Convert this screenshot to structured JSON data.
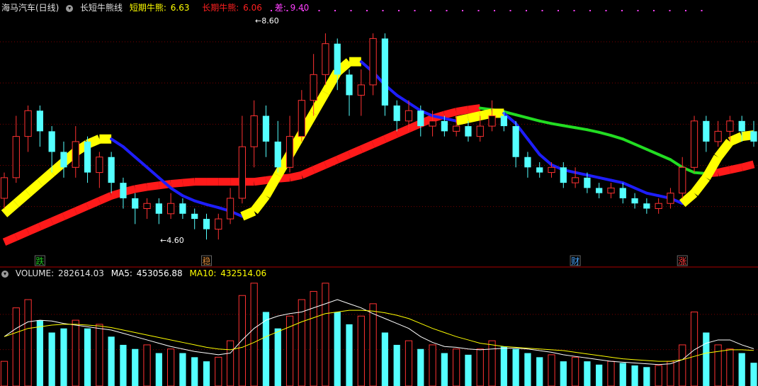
{
  "top_panel": {
    "stock_name": "海马汽车(日线)",
    "indicator_name": "长短牛熊线",
    "short_label": "短期牛熊:",
    "short_value": "6.63",
    "long_label": "长期牛熊:",
    "long_value": "6.06",
    "diff_label": "差:",
    "diff_value": "9.40",
    "high_marker": "8.60",
    "low_marker": "4.60",
    "signals": [
      {
        "label": "跌",
        "color": "#21c021"
      },
      {
        "label": "稳",
        "color": "#d98a3a"
      },
      {
        "label": "财",
        "color": "#4aa8ff"
      },
      {
        "label": "涨",
        "color": "#ff3c3c"
      }
    ]
  },
  "bottom_panel": {
    "volume_label": "VOLUME:",
    "volume_value": "282614.03",
    "ma5_label": "MA5:",
    "ma5_value": "453056.88",
    "ma10_label": "MA10:",
    "ma10_value": "432514.06"
  },
  "colors": {
    "up_candle": "#ff3232",
    "down_candle": "#54ffff",
    "short_line_rising": "#ffff00",
    "short_line_falling": "#1e1eff",
    "long_line_rising": "#ff1a1a",
    "long_line_falling": "#22dd22",
    "ma5": "#ffffff",
    "ma10": "#ffff00",
    "grid": "#7a0000"
  },
  "chart_data": {
    "type": "candlestick",
    "price_ylim": [
      4.3,
      9.0
    ],
    "volume_ylim": [
      0,
      1300000
    ],
    "short_line": [
      5.1,
      5.3,
      5.5,
      5.7,
      5.9,
      6.1,
      6.3,
      6.45,
      6.55,
      6.55,
      6.4,
      6.2,
      6.0,
      5.8,
      5.6,
      5.45,
      5.35,
      5.28,
      5.22,
      5.15,
      5.05,
      5.15,
      5.45,
      5.85,
      6.25,
      6.65,
      7.05,
      7.45,
      7.85,
      8.05,
      8.05,
      7.85,
      7.6,
      7.4,
      7.25,
      7.1,
      7.0,
      6.95,
      6.9,
      6.95,
      7.0,
      7.05,
      7.05,
      6.85,
      6.55,
      6.25,
      6.05,
      5.95,
      5.9,
      5.85,
      5.8,
      5.75,
      5.7,
      5.6,
      5.5,
      5.45,
      5.4,
      5.3,
      5.5,
      5.8,
      6.2,
      6.5,
      6.6,
      6.63
    ],
    "long_line": [
      4.55,
      4.65,
      4.75,
      4.85,
      4.95,
      5.05,
      5.15,
      5.25,
      5.35,
      5.45,
      5.52,
      5.58,
      5.62,
      5.65,
      5.68,
      5.7,
      5.72,
      5.72,
      5.72,
      5.72,
      5.72,
      5.72,
      5.75,
      5.78,
      5.8,
      5.85,
      5.95,
      6.05,
      6.15,
      6.25,
      6.35,
      6.45,
      6.55,
      6.65,
      6.75,
      6.85,
      6.95,
      7.02,
      7.08,
      7.12,
      7.15,
      7.12,
      7.08,
      7.02,
      6.96,
      6.9,
      6.85,
      6.81,
      6.77,
      6.73,
      6.68,
      6.62,
      6.55,
      6.45,
      6.35,
      6.25,
      6.15,
      6.0,
      5.9,
      5.88,
      5.9,
      5.95,
      6.0,
      6.06
    ],
    "candles": [
      [
        5.4,
        5.8,
        5.9,
        5.2
      ],
      [
        5.8,
        6.6,
        7.0,
        5.7
      ],
      [
        6.6,
        7.1,
        7.2,
        6.3
      ],
      [
        7.1,
        6.7,
        7.2,
        6.4
      ],
      [
        6.7,
        6.3,
        6.8,
        5.9
      ],
      [
        6.3,
        6.0,
        6.5,
        5.8
      ],
      [
        6.0,
        6.5,
        6.8,
        5.8
      ],
      [
        6.5,
        5.9,
        6.6,
        5.7
      ],
      [
        5.9,
        6.2,
        6.3,
        5.6
      ],
      [
        6.2,
        5.7,
        6.3,
        5.5
      ],
      [
        5.7,
        5.4,
        5.8,
        5.2
      ],
      [
        5.4,
        5.2,
        5.5,
        4.9
      ],
      [
        5.2,
        5.3,
        5.4,
        5.0
      ],
      [
        5.3,
        5.1,
        5.4,
        4.9
      ],
      [
        5.1,
        5.3,
        5.5,
        5.0
      ],
      [
        5.3,
        5.1,
        5.4,
        5.0
      ],
      [
        5.1,
        5.0,
        5.2,
        4.8
      ],
      [
        5.0,
        4.8,
        5.1,
        4.6
      ],
      [
        4.8,
        5.0,
        5.1,
        4.6
      ],
      [
        5.0,
        5.4,
        5.6,
        4.9
      ],
      [
        5.4,
        6.4,
        7.0,
        5.3
      ],
      [
        6.4,
        7.0,
        7.3,
        6.0
      ],
      [
        7.0,
        6.5,
        7.2,
        6.2
      ],
      [
        6.5,
        6.0,
        6.9,
        5.9
      ],
      [
        6.0,
        6.6,
        7.0,
        5.9
      ],
      [
        6.6,
        7.3,
        7.5,
        6.5
      ],
      [
        7.3,
        7.8,
        8.2,
        7.0
      ],
      [
        7.8,
        8.4,
        8.6,
        7.6
      ],
      [
        8.4,
        7.8,
        8.5,
        7.5
      ],
      [
        7.8,
        7.4,
        7.9,
        7.0
      ],
      [
        7.4,
        7.6,
        7.9,
        7.0
      ],
      [
        7.6,
        8.5,
        8.6,
        7.4
      ],
      [
        8.5,
        7.2,
        8.6,
        7.0
      ],
      [
        7.2,
        6.9,
        7.3,
        6.7
      ],
      [
        6.9,
        7.1,
        7.3,
        6.7
      ],
      [
        7.1,
        6.8,
        7.2,
        6.6
      ],
      [
        6.8,
        6.9,
        7.1,
        6.6
      ],
      [
        6.9,
        6.7,
        7.0,
        6.6
      ],
      [
        6.7,
        6.8,
        7.0,
        6.6
      ],
      [
        6.8,
        6.6,
        6.9,
        6.5
      ],
      [
        6.6,
        6.8,
        7.0,
        6.5
      ],
      [
        6.8,
        7.0,
        7.3,
        6.7
      ],
      [
        7.0,
        6.8,
        7.1,
        6.7
      ],
      [
        6.8,
        6.2,
        6.9,
        6.0
      ],
      [
        6.2,
        6.0,
        6.3,
        5.8
      ],
      [
        6.0,
        5.9,
        6.1,
        5.8
      ],
      [
        5.9,
        6.0,
        6.1,
        5.8
      ],
      [
        6.0,
        5.7,
        6.1,
        5.6
      ],
      [
        5.7,
        5.8,
        6.0,
        5.6
      ],
      [
        5.8,
        5.6,
        5.9,
        5.5
      ],
      [
        5.6,
        5.5,
        5.7,
        5.4
      ],
      [
        5.5,
        5.6,
        5.7,
        5.4
      ],
      [
        5.6,
        5.4,
        5.7,
        5.3
      ],
      [
        5.4,
        5.3,
        5.5,
        5.2
      ],
      [
        5.3,
        5.2,
        5.4,
        5.1
      ],
      [
        5.2,
        5.3,
        5.4,
        5.1
      ],
      [
        5.3,
        5.5,
        5.6,
        5.2
      ],
      [
        5.5,
        6.0,
        6.2,
        5.4
      ],
      [
        6.0,
        6.9,
        7.0,
        5.9
      ],
      [
        6.9,
        6.5,
        7.0,
        6.3
      ],
      [
        6.5,
        6.7,
        6.9,
        6.4
      ],
      [
        6.7,
        6.9,
        7.0,
        6.5
      ],
      [
        6.9,
        6.7,
        7.0,
        6.5
      ],
      [
        6.7,
        6.5,
        6.9,
        6.4
      ]
    ],
    "volume": [
      300000,
      950000,
      1050000,
      800000,
      650000,
      700000,
      800000,
      700000,
      750000,
      600000,
      500000,
      450000,
      500000,
      400000,
      450000,
      400000,
      350000,
      300000,
      350000,
      550000,
      1100000,
      1250000,
      900000,
      700000,
      850000,
      1050000,
      1150000,
      1250000,
      900000,
      750000,
      850000,
      1000000,
      650000,
      500000,
      550000,
      450000,
      500000,
      400000,
      450000,
      380000,
      450000,
      550000,
      480000,
      450000,
      400000,
      350000,
      380000,
      300000,
      350000,
      300000,
      260000,
      300000,
      280000,
      250000,
      230000,
      250000,
      300000,
      500000,
      900000,
      650000,
      500000,
      450000,
      400000,
      282614
    ],
    "ma5": [
      600000,
      700000,
      780000,
      800000,
      790000,
      760000,
      740000,
      720000,
      700000,
      680000,
      640000,
      600000,
      560000,
      520000,
      480000,
      450000,
      420000,
      400000,
      380000,
      400000,
      560000,
      700000,
      800000,
      850000,
      880000,
      900000,
      950000,
      1000000,
      1050000,
      1000000,
      950000,
      880000,
      820000,
      760000,
      700000,
      600000,
      530000,
      480000,
      470000,
      450000,
      440000,
      450000,
      460000,
      460000,
      450000,
      430000,
      410000,
      380000,
      360000,
      340000,
      320000,
      300000,
      290000,
      280000,
      270000,
      260000,
      270000,
      320000,
      440000,
      520000,
      560000,
      560000,
      500000,
      453057
    ],
    "ma10": [
      600000,
      650000,
      700000,
      720000,
      740000,
      750000,
      750000,
      740000,
      730000,
      710000,
      680000,
      650000,
      620000,
      590000,
      560000,
      530000,
      500000,
      470000,
      450000,
      440000,
      470000,
      530000,
      600000,
      660000,
      720000,
      780000,
      830000,
      880000,
      900000,
      920000,
      920000,
      910000,
      890000,
      860000,
      820000,
      760000,
      700000,
      650000,
      600000,
      560000,
      520000,
      500000,
      480000,
      470000,
      460000,
      450000,
      440000,
      430000,
      410000,
      390000,
      370000,
      350000,
      330000,
      320000,
      310000,
      300000,
      300000,
      320000,
      360000,
      400000,
      420000,
      440000,
      440000,
      432514
    ]
  }
}
